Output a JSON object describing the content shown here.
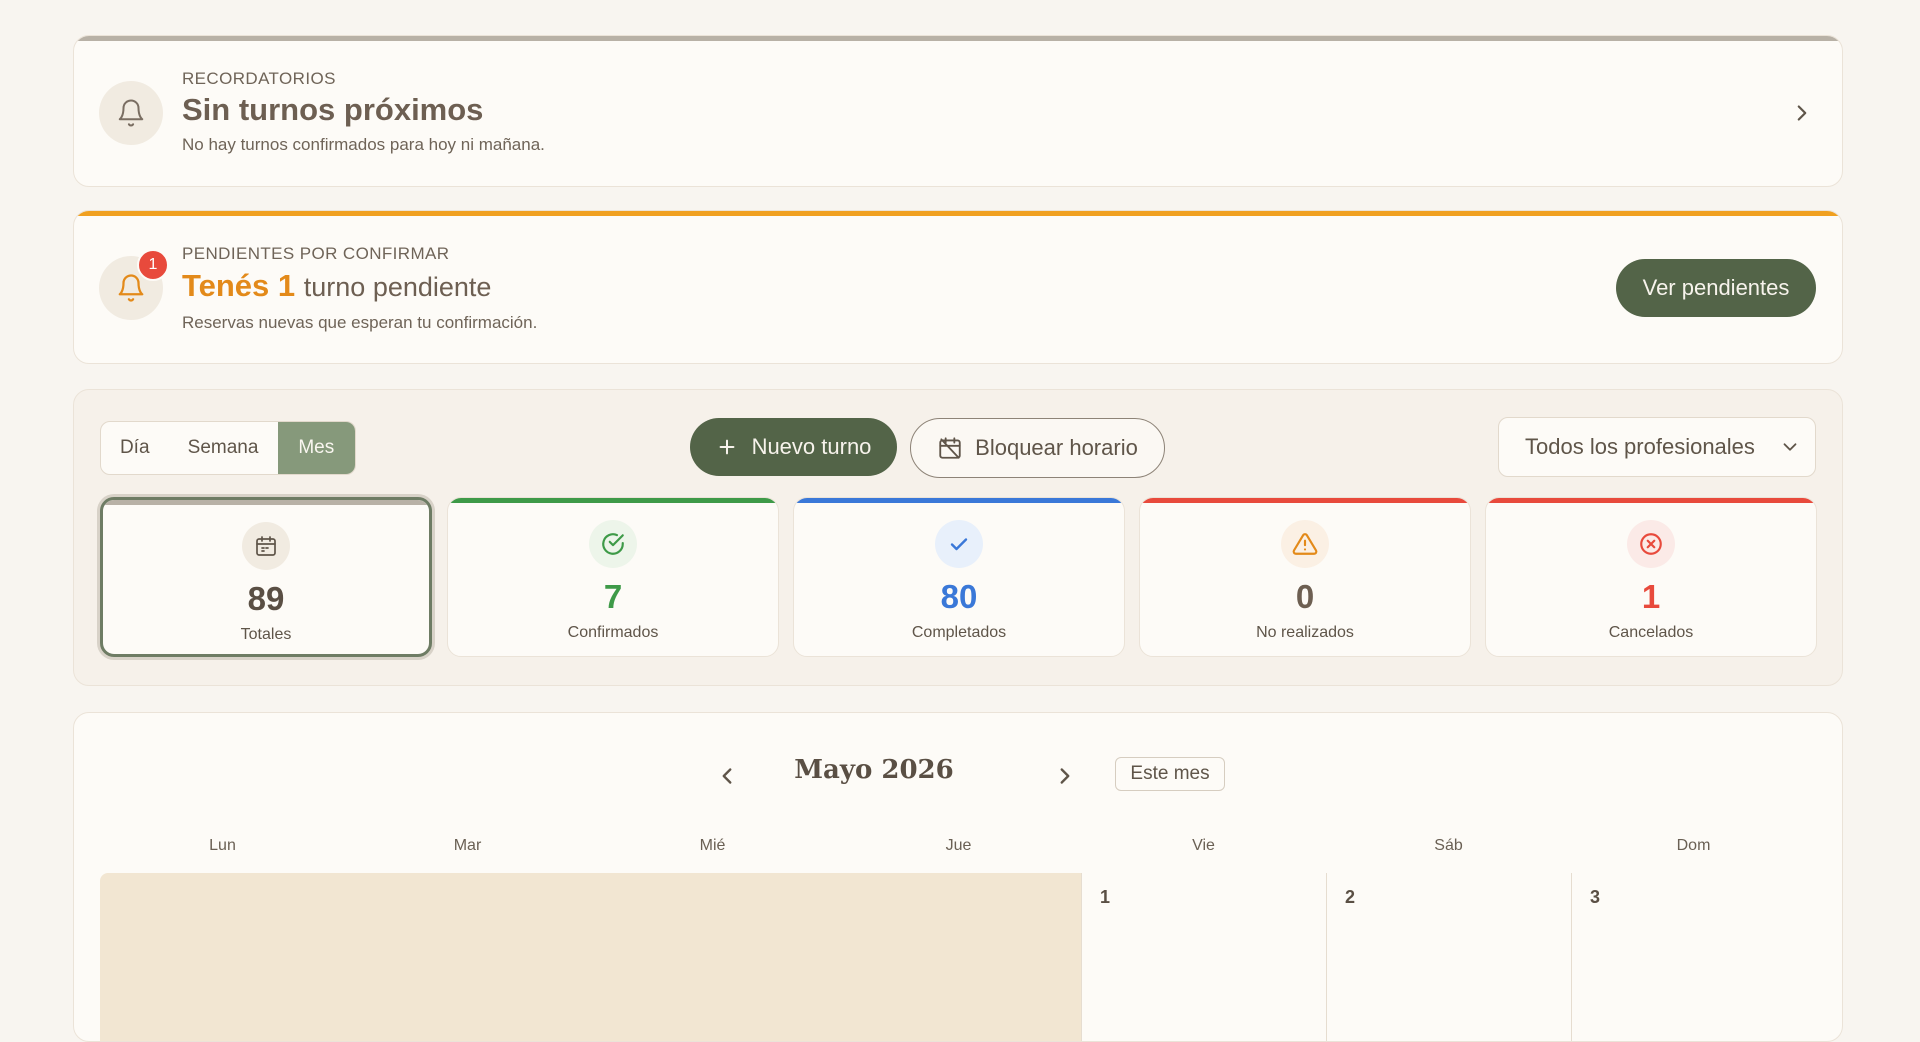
{
  "reminders": {
    "eyebrow": "RECORDATORIOS",
    "title": "Sin turnos próximos",
    "subtitle": "No hay turnos confirmados para hoy ni mañana."
  },
  "pending": {
    "eyebrow": "PENDIENTES POR CONFIRMAR",
    "title_emphasis": "Tenés 1",
    "title_rest": "turno pendiente",
    "subtitle": "Reservas nuevas que esperan tu confirmación.",
    "badge_count": "1",
    "button_label": "Ver pendientes"
  },
  "toolbar": {
    "views": [
      "Día",
      "Semana",
      "Mes"
    ],
    "active_view": "Mes",
    "new_button": "Nuevo turno",
    "block_button": "Bloquear horario",
    "professional_select": "Todos los profesionales"
  },
  "stats": [
    {
      "value": "89",
      "label": "Totales",
      "color": "#5a4f44",
      "accent": "#b8b1a6",
      "icon": "calendar-icon"
    },
    {
      "value": "7",
      "label": "Confirmados",
      "color": "#3e9a48",
      "accent": "#3e9a48",
      "icon": "check-circle-icon"
    },
    {
      "value": "80",
      "label": "Completados",
      "color": "#3a78d8",
      "accent": "#3a78d8",
      "icon": "check-icon"
    },
    {
      "value": "0",
      "label": "No realizados",
      "color": "#6d5f52",
      "accent": "#e84a3c",
      "icon": "warning-icon"
    },
    {
      "value": "1",
      "label": "Cancelados",
      "color": "#e84a3c",
      "accent": "#e84a3c",
      "icon": "x-circle-icon"
    }
  ],
  "calendar": {
    "month_title": "Mayo 2026",
    "today_button": "Este mes",
    "weekdays": [
      "Lun",
      "Mar",
      "Mié",
      "Jue",
      "Vie",
      "Sáb",
      "Dom"
    ],
    "first_row_days": [
      "1",
      "2",
      "3"
    ]
  },
  "colors": {
    "primary": "#536448",
    "pending_accent": "#f0a020",
    "reminder_accent": "#b8b1a6"
  }
}
